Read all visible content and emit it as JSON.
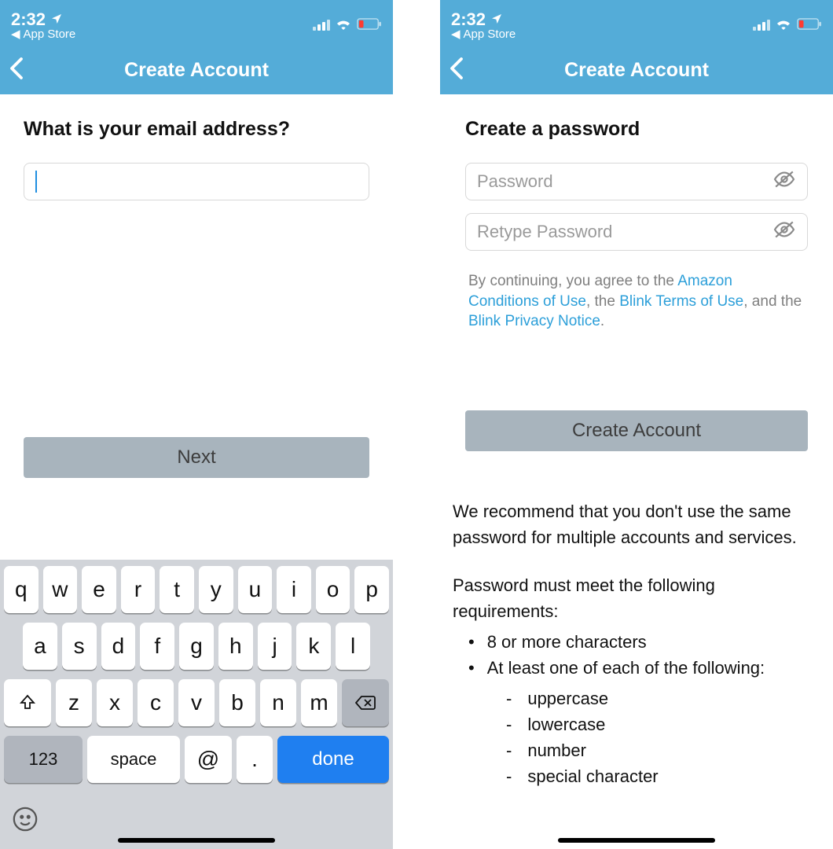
{
  "status": {
    "time": "2:32",
    "back_app": "App Store"
  },
  "left": {
    "title": "Create Account",
    "heading": "What is your email address?",
    "next_label": "Next",
    "keyboard": {
      "row1": [
        "q",
        "w",
        "e",
        "r",
        "t",
        "y",
        "u",
        "i",
        "o",
        "p"
      ],
      "row2": [
        "a",
        "s",
        "d",
        "f",
        "g",
        "h",
        "j",
        "k",
        "l"
      ],
      "row3": [
        "z",
        "x",
        "c",
        "v",
        "b",
        "n",
        "m"
      ],
      "num_label": "123",
      "space_label": "space",
      "at_label": "@",
      "dot_label": ".",
      "done_label": "done"
    }
  },
  "right": {
    "title": "Create Account",
    "heading": "Create a password",
    "password_placeholder": "Password",
    "retype_placeholder": "Retype Password",
    "legal": {
      "prefix": "By continuing, you agree to the ",
      "link1": "Amazon Conditions of Use",
      "mid1": ", the ",
      "link2": "Blink Terms of Use",
      "mid2": ", and the ",
      "link3": "Blink Privacy Notice",
      "suffix": "."
    },
    "create_label": "Create Account",
    "reco_intro": "We recommend that you don't use the same password for multiple accounts and services.",
    "reco_heading": "Password must meet the following requirements:",
    "req1": "8 or more characters",
    "req2": "At least one of each of the following:",
    "sub": [
      "uppercase",
      "lowercase",
      "number",
      "special character"
    ]
  }
}
